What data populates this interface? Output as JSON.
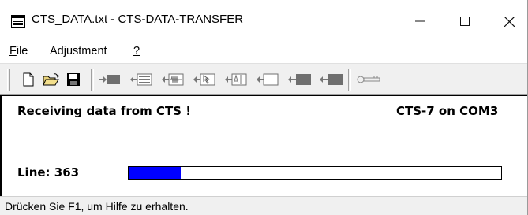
{
  "window": {
    "title": "CTS_DATA.txt - CTS-DATA-TRANSFER",
    "minimize_glyph": "—",
    "maximize_glyph": "☐",
    "close_glyph": "✕"
  },
  "menu": {
    "items": [
      {
        "label": "File",
        "mnemonic": "F",
        "rest": "ile"
      },
      {
        "label": "Adjustment",
        "mnemonic": "",
        "rest": "Adjustment"
      },
      {
        "label": "?",
        "mnemonic": "?",
        "rest": ""
      }
    ]
  },
  "toolbar": {
    "buttons": [
      "new-file-icon",
      "open-folder-icon",
      "save-disk-icon",
      "send-block-icon",
      "receive-table-icon",
      "receive-waveform-icon",
      "receive-cursor-icon",
      "receive-ai-icon",
      "receive-empty-icon",
      "send-device-icon",
      "receive-device-icon",
      "key-icon"
    ],
    "accent": "#4a4a4a"
  },
  "main": {
    "status_message": "Receiving data from CTS !",
    "device_info": "CTS-7 on COM3",
    "line_label": "Line: 363",
    "progress_fraction": 0.14,
    "progress_color": "#0000ff"
  },
  "statusbar": {
    "text": "Drücken Sie F1, um Hilfe zu erhalten."
  }
}
